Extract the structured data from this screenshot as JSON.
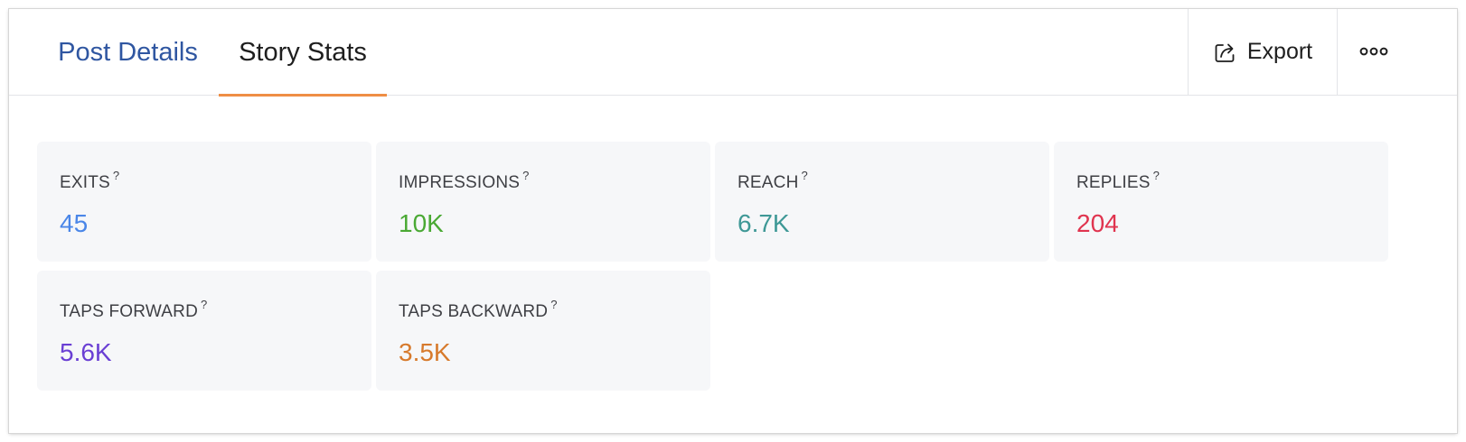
{
  "tabs": [
    {
      "label": "Post Details",
      "active": false
    },
    {
      "label": "Story Stats",
      "active": true
    }
  ],
  "toolbar": {
    "export_label": "Export",
    "export_icon": "export-share-icon",
    "more_icon": "more-options-icon"
  },
  "colors": {
    "accent_underline": "#ef8e45",
    "tab_link": "#2f56a1"
  },
  "stats": [
    {
      "label": "EXITS",
      "help": "?",
      "value": "45",
      "color": "#4a86e8"
    },
    {
      "label": "IMPRESSIONS",
      "help": "?",
      "value": "10K",
      "color": "#4aa934"
    },
    {
      "label": "REACH",
      "help": "?",
      "value": "6.7K",
      "color": "#3e9896"
    },
    {
      "label": "REPLIES",
      "help": "?",
      "value": "204",
      "color": "#e0344f"
    },
    {
      "label": "TAPS FORWARD",
      "help": "?",
      "value": "5.6K",
      "color": "#6a3fd4"
    },
    {
      "label": "TAPS BACKWARD",
      "help": "?",
      "value": "3.5K",
      "color": "#d77a2c"
    }
  ]
}
